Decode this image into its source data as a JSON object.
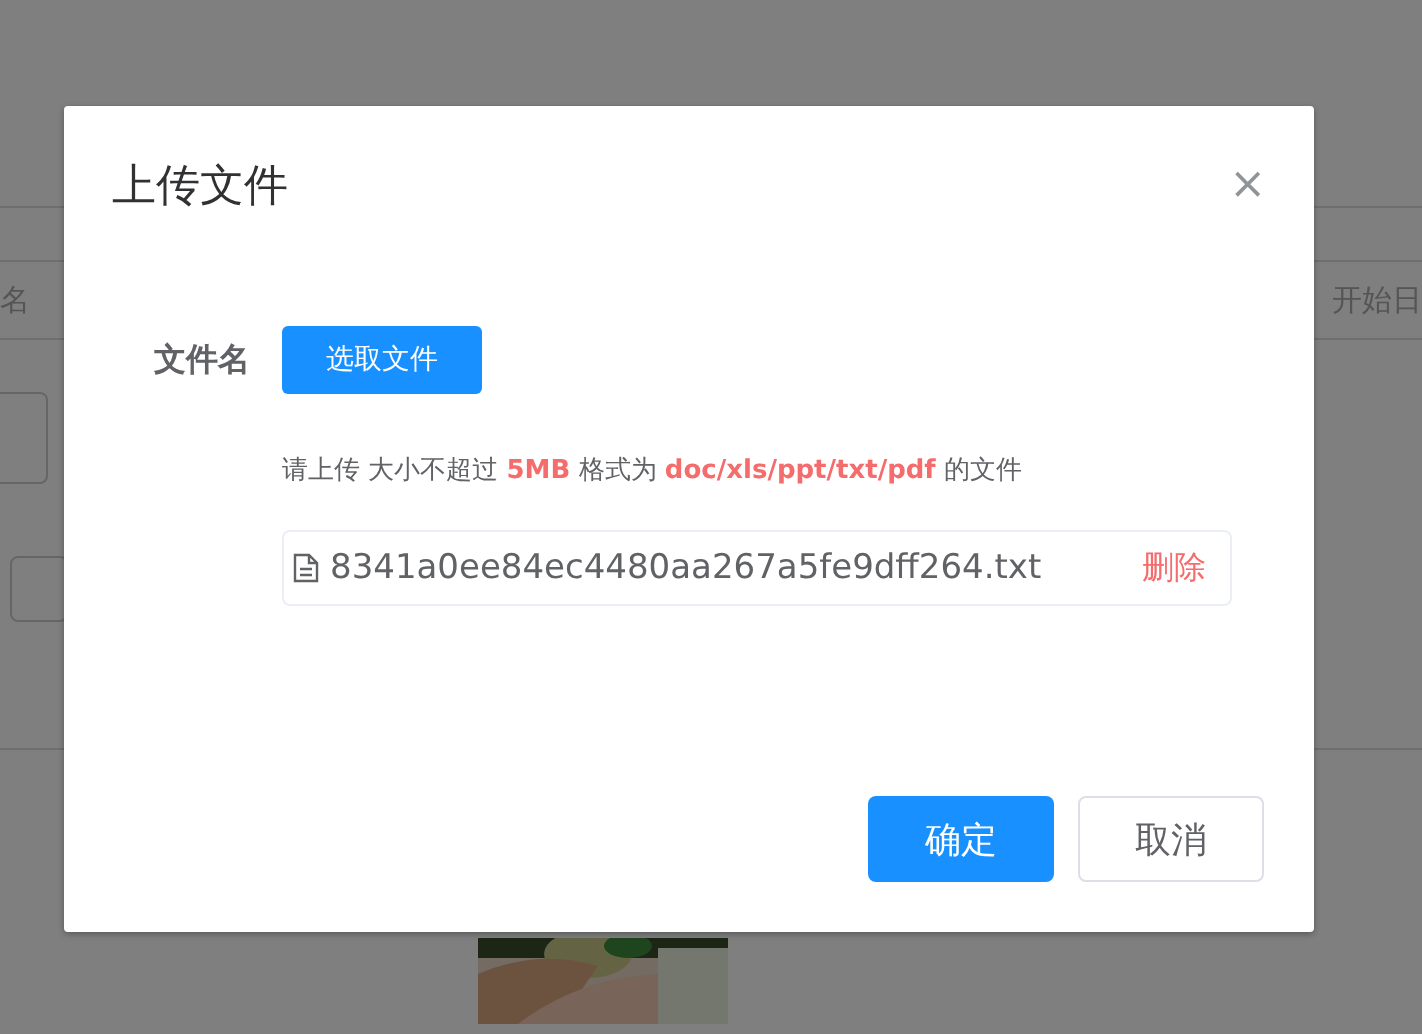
{
  "background": {
    "fields": [
      {
        "placeholder": "名"
      },
      {
        "placeholder": "开始日"
      }
    ]
  },
  "dialog": {
    "title": "上传文件",
    "close": "×",
    "field_label": "文件名",
    "select_button": "选取文件",
    "hint": "请上传 大小不超过 **5MB** 格式为 **doc/xls/ppt/txt/pdf** 的文件",
    "files": [
      {
        "name": "8341a0ee84ec4480aa267a5fe9dff264.txt",
        "action": "删除"
      }
    ],
    "buttons": [
      {
        "label": "确定",
        "kind": "primary"
      },
      {
        "label": "取消",
        "kind": "default"
      }
    ]
  }
}
